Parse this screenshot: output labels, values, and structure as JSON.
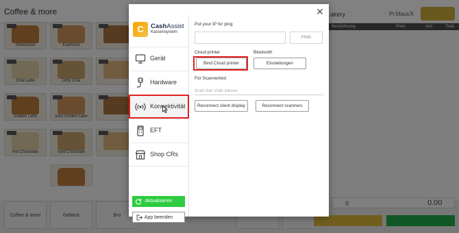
{
  "background": {
    "category_title": "Coffee & more",
    "right_header_label": "akery",
    "right_header_small": "Pr.Maus",
    "right_header_x": "X",
    "table_headers": [
      "Bezeichnung",
      "Preis",
      "Anz.",
      "Total"
    ],
    "products": [
      {
        "name": "Americano",
        "price": "4.00"
      },
      {
        "name": "Espresso",
        "price": "3.50"
      },
      {
        "name": "",
        "price": "4.00"
      },
      {
        "name": "Chai Latte",
        "price": "5.00"
      },
      {
        "name": "Dirty Chai",
        "price": "5.50"
      },
      {
        "name": "",
        "price": "5.00"
      },
      {
        "name": "Golden Latte",
        "price": "5.50"
      },
      {
        "name": "Iced Golden Latte",
        "price": "6.00"
      },
      {
        "name": "",
        "price": "5.50"
      },
      {
        "name": "Hot Chocolate",
        "price": "5.00"
      },
      {
        "name": "Iced Chocolate",
        "price": "5.50"
      },
      {
        "name": "",
        "price": "5.00"
      }
    ],
    "bottom_categories": [
      "Coffee & more",
      "Gebäck",
      "Bro"
    ],
    "num_left": "0",
    "num_right": "0.00"
  },
  "modal": {
    "close_icon": "close-icon",
    "logo": {
      "mark": "C",
      "name_bold": "Cash",
      "name_rest": "Assist",
      "sub": "Kassensystem"
    },
    "nav": [
      {
        "label": "Gerät",
        "icon": "monitor-icon"
      },
      {
        "label": "Hardware",
        "icon": "usb-plug-icon"
      },
      {
        "label": "Konnektivität",
        "icon": "broadcast-icon"
      },
      {
        "label": "EFT",
        "icon": "payment-terminal-icon"
      },
      {
        "label": "Shop CRs",
        "icon": "shop-icon"
      }
    ],
    "active_nav": "Konnektivität",
    "refresh_button": "Aktualisieren",
    "exit_button": "App beenden",
    "ping": {
      "label": "Put your IP for ping",
      "value": "",
      "button": "PING"
    },
    "cloud_printer": {
      "label": "Cloud printer",
      "button": "Bind Cloud printer"
    },
    "bluetooth": {
      "label": "Bluetooth",
      "button": "Einstellungen"
    },
    "scanner_test": {
      "label": "Für Scannertest",
      "placeholder": "Scan bar code please"
    },
    "reconnect_display_button": "Reconnect client display",
    "reconnect_scanners_button": "Reconnect scanners",
    "highlight_color": "#e02020",
    "accent_green": "#2ecc40",
    "brand_orange": "#f7a600"
  }
}
